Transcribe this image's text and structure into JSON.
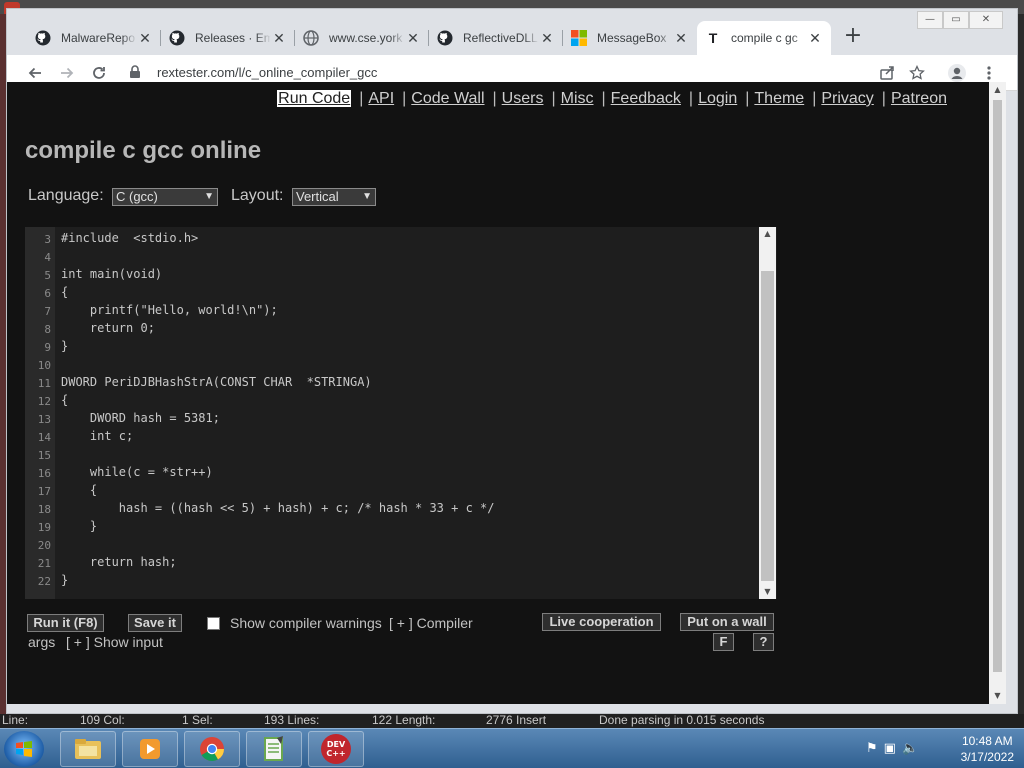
{
  "background_window": {
    "title": ""
  },
  "browser": {
    "tabs": [
      {
        "title": "MalwareRepo",
        "icon": "github-icon"
      },
      {
        "title": "Releases · Em",
        "icon": "github-icon"
      },
      {
        "title": "www.cse.york",
        "icon": "globe-icon"
      },
      {
        "title": "ReflectiveDLL",
        "icon": "github-icon"
      },
      {
        "title": "MessageBox",
        "icon": "microsoft-icon"
      },
      {
        "title": "compile c gc",
        "icon": "t-icon",
        "active": true
      }
    ],
    "new_tab_glyph": "+",
    "address": "rextester.com/l/c_online_compiler_gcc",
    "window_controls": {
      "minimize": "—",
      "restore": "▭",
      "close": "✕"
    }
  },
  "site": {
    "nav": [
      {
        "label": "Run Code",
        "active": true
      },
      {
        "label": "API"
      },
      {
        "label": "Code Wall"
      },
      {
        "label": "Users"
      },
      {
        "label": "Misc"
      },
      {
        "label": "Feedback"
      },
      {
        "label": "Login"
      },
      {
        "label": "Theme"
      },
      {
        "label": "Privacy"
      },
      {
        "label": "Patreon"
      }
    ],
    "title": "compile c gcc online",
    "language_label": "Language:",
    "language_value": "C (gcc)",
    "layout_label": "Layout:",
    "layout_value": "Vertical"
  },
  "editor": {
    "line_numbers": [
      "3",
      "4",
      "5",
      "6",
      "7",
      "8",
      "9",
      "10",
      "11",
      "12",
      "13",
      "14",
      "15",
      "16",
      "17",
      "18",
      "19",
      "20",
      "21",
      "22"
    ],
    "lines": [
      "#include  <stdio.h>",
      "",
      "int main(void)",
      "{",
      "    printf(\"Hello, world!\\n\");",
      "    return 0;",
      "}",
      "",
      "DWORD PeriDJBHashStrA(CONST CHAR  *STRINGA)",
      "{",
      "    DWORD hash = 5381;",
      "    int c;",
      "",
      "    while(c = *str++)",
      "    {",
      "        hash = ((hash << 5) + hash) + c; /* hash * 33 + c */",
      "    }",
      "",
      "    return hash;",
      "}"
    ]
  },
  "controls": {
    "run_label": "Run it (F8)",
    "save_label": "Save it",
    "warnings_label": "Show compiler warnings",
    "warnings_checked": false,
    "compiler_args_label": "[ + ] Compiler",
    "args_label": "args",
    "show_input_label": "[ + ] Show input",
    "live_coop_label": "Live cooperation",
    "put_wall_label": "Put on a wall",
    "f_label": "F",
    "help_label": "?"
  },
  "editor_status": {
    "line": "Line:",
    "line_val": "109 Col:",
    "sel": "1 Sel:",
    "lines": "193 Lines:",
    "length": "122 Length:",
    "insert": "2776 Insert",
    "parse": "Done parsing in 0.015 seconds"
  },
  "taskbar": {
    "apps": [
      "explorer",
      "media",
      "chrome",
      "notepad",
      "devcpp"
    ],
    "devcpp_label": "DEV C++",
    "time": "10:48 AM",
    "date": "3/17/2022"
  }
}
